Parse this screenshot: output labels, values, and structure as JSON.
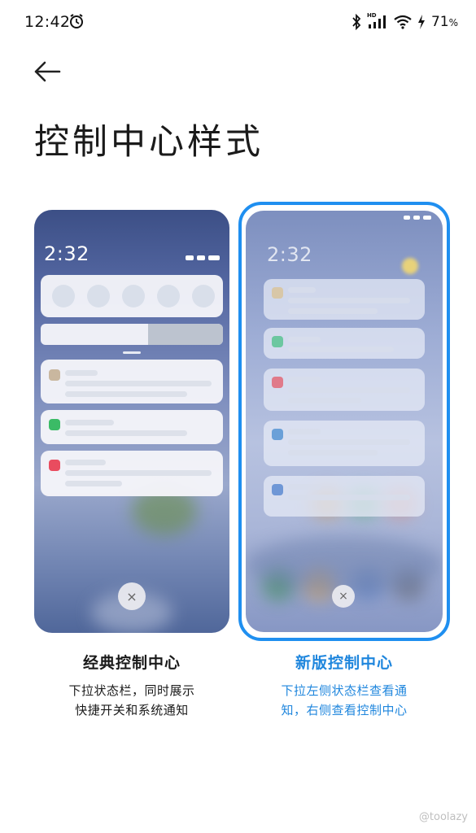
{
  "status_bar": {
    "time": "12:42",
    "battery": "71",
    "battery_unit": "%",
    "network_badge": "HD"
  },
  "header": {
    "title": "控制中心样式"
  },
  "options": [
    {
      "id": "classic",
      "title": "经典控制中心",
      "desc_line1": "下拉状态栏，同时展示",
      "desc_line2": "快捷开关和系统通知",
      "preview_time": "2:32",
      "selected": false
    },
    {
      "id": "new",
      "title": "新版控制中心",
      "desc_line1": "下拉左侧状态栏查看通",
      "desc_line2": "知，右侧查看控制中心",
      "preview_time": "2:32",
      "selected": true
    }
  ],
  "close_glyph": "×",
  "colors": {
    "accent": "#1f8ff0",
    "accent_text": "#1f86dd"
  },
  "watermark": "@toolazy"
}
